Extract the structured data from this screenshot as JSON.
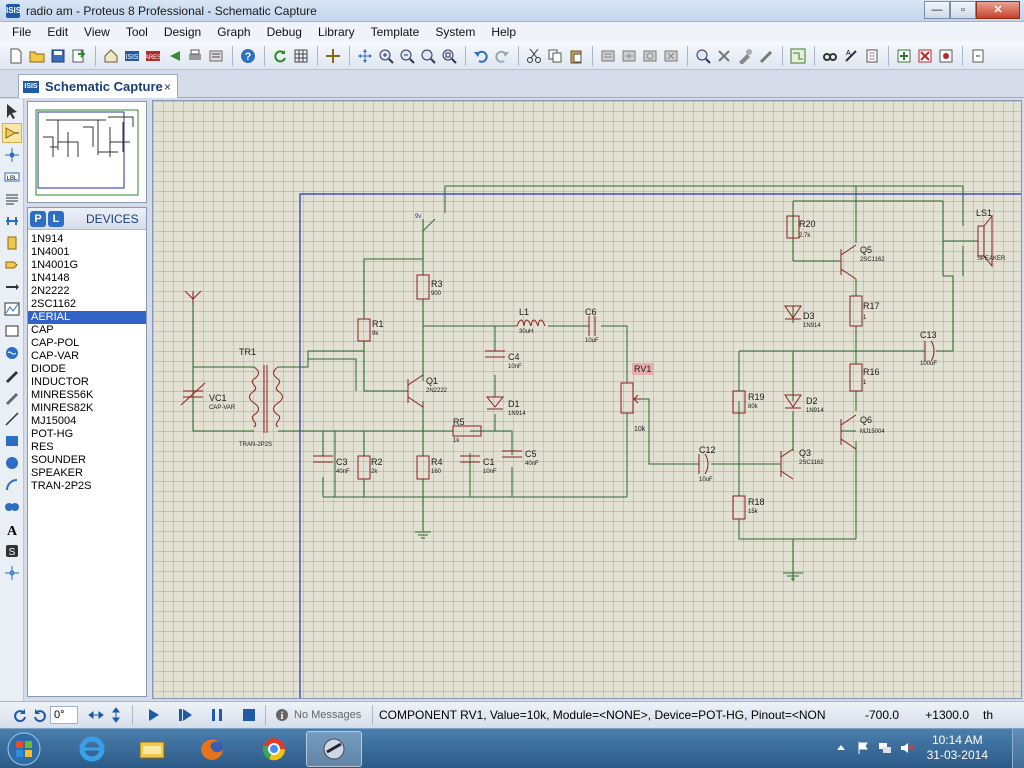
{
  "window": {
    "title": "radio am - Proteus 8 Professional - Schematic Capture",
    "controls": {
      "minimize": "—",
      "maximize": "▫",
      "close": "✕"
    }
  },
  "menu": [
    "File",
    "Edit",
    "View",
    "Tool",
    "Design",
    "Graph",
    "Debug",
    "Library",
    "Template",
    "System",
    "Help"
  ],
  "tab": {
    "label": "Schematic Capture",
    "close": "×"
  },
  "devices": {
    "title": "DEVICES",
    "p_button": "P",
    "l_button": "L",
    "items": [
      "1N914",
      "1N4001",
      "1N4001G",
      "1N4148",
      "2N2222",
      "2SC1162",
      "AERIAL",
      "CAP",
      "CAP-POL",
      "CAP-VAR",
      "DIODE",
      "INDUCTOR",
      "MINRES56K",
      "MINRES82K",
      "MJ15004",
      "POT-HG",
      "RES",
      "SOUNDER",
      "SPEAKER",
      "TRAN-2P2S"
    ],
    "selected_index": 6
  },
  "schematic": {
    "components": {
      "TR1": {
        "ref": "TR1",
        "value": "TRAN-2P2S"
      },
      "VC1": {
        "ref": "VC1",
        "value": "CAP-VAR"
      },
      "R1": {
        "ref": "R1",
        "value": "9k"
      },
      "R2": {
        "ref": "R2",
        "value": "2k"
      },
      "R3": {
        "ref": "R3",
        "value": "900"
      },
      "R4": {
        "ref": "R4",
        "value": "160"
      },
      "R5": {
        "ref": "R5",
        "value": "1k"
      },
      "C1": {
        "ref": "C1",
        "value": "10nF"
      },
      "C3": {
        "ref": "C3",
        "value": "40nF"
      },
      "C4": {
        "ref": "C4",
        "value": "10nF"
      },
      "C5": {
        "ref": "C5",
        "value": "40nF"
      },
      "C6": {
        "ref": "C6",
        "value": "10uF"
      },
      "D1": {
        "ref": "D1",
        "value": "1N914"
      },
      "L1": {
        "ref": "L1",
        "value": "30uH"
      },
      "Q1": {
        "ref": "Q1",
        "value": "2N2222"
      },
      "RV1": {
        "ref": "RV1",
        "value": "10k"
      },
      "C12": {
        "ref": "C12",
        "value": "10uF"
      },
      "R18": {
        "ref": "R18",
        "value": "15k"
      },
      "R19": {
        "ref": "R19",
        "value": "80k"
      },
      "Q3": {
        "ref": "Q3",
        "value": "2SC1162"
      },
      "D2": {
        "ref": "D2",
        "value": "1N914"
      },
      "D3": {
        "ref": "D3",
        "value": "1N914"
      },
      "R20": {
        "ref": "R20",
        "value": "2.7k"
      },
      "Q5": {
        "ref": "Q5",
        "value": "2SC1162"
      },
      "R17": {
        "ref": "R17",
        "value": "1"
      },
      "R16": {
        "ref": "R16",
        "value": "1"
      },
      "Q6": {
        "ref": "Q6",
        "value": "MJ15004"
      },
      "C13": {
        "ref": "C13",
        "value": "100uF"
      },
      "LS1": {
        "ref": "LS1",
        "value": "SPEAKER"
      }
    },
    "supply_label": "9v"
  },
  "status": {
    "rotation": "0°",
    "messages": "No Messages",
    "component_info": "COMPONENT RV1, Value=10k, Module=<NONE>, Device=POT-HG, Pinout=<NON",
    "x_coord": "-700.0",
    "y_coord": "+1300.0",
    "units": "th"
  },
  "taskbar": {
    "time": "10:14 AM",
    "date": "31-03-2014"
  },
  "colors": {
    "wire": "#2a6a2a",
    "component": "#8a1f1f",
    "sheet_border": "#2233aa",
    "grid_bg": "#e3e0d4",
    "selected": "#3264c8"
  },
  "icons": [
    "new-icon",
    "open-icon",
    "save-icon",
    "import-icon",
    "home-icon",
    "isis-icon",
    "ares-icon",
    "back-icon",
    "print-icon",
    "help-icon",
    "refresh-icon",
    "grid-icon",
    "origin-icon",
    "pan-icon",
    "zoom-in-icon",
    "zoom-out-icon",
    "zoom-all-icon",
    "zoom-area-icon",
    "undo-icon",
    "redo-icon",
    "cut-icon",
    "copy-icon",
    "paste-icon",
    "block-copy-icon",
    "block-move-icon",
    "block-rotate-icon",
    "block-delete-icon",
    "pick-icon",
    "make-device-icon",
    "package-icon",
    "decompose-icon",
    "wire-autorouter-icon",
    "search-icon",
    "property-icon",
    "netlist-icon",
    "bom-icon",
    "erc-icon",
    "netlist-ares-icon"
  ]
}
